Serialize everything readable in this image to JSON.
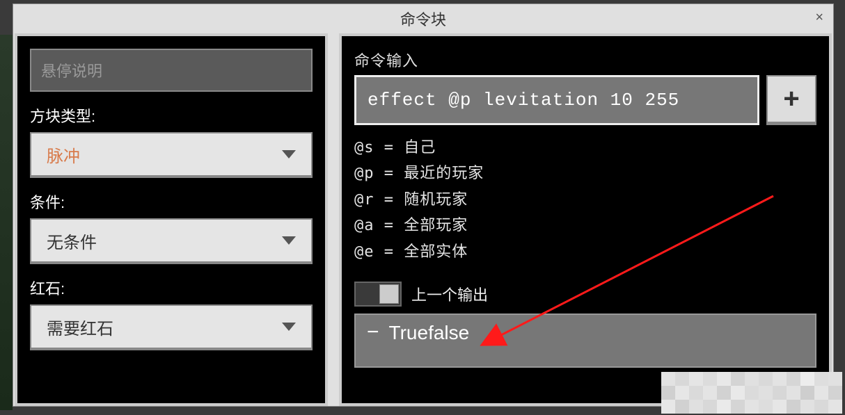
{
  "title": "命令块",
  "left": {
    "hover_placeholder": "悬停说明",
    "block_type_label": "方块类型:",
    "block_type_value": "脉冲",
    "condition_label": "条件:",
    "condition_value": "无条件",
    "redstone_label": "红石:",
    "redstone_value": "需要红石"
  },
  "right": {
    "command_input_label": "命令输入",
    "command_value": "effect @p levitation 10 255",
    "plus_label": "+",
    "selectors": [
      "@s = 自己",
      "@p = 最近的玩家",
      "@r = 随机玩家",
      "@a = 全部玩家",
      "@e = 全部实体"
    ],
    "prev_output_label": "上一个输出",
    "output_minus": "−",
    "output_text": "Truefalse"
  },
  "colors": {
    "accent": "#d87a4a",
    "arrow": "#ff1a1a"
  }
}
